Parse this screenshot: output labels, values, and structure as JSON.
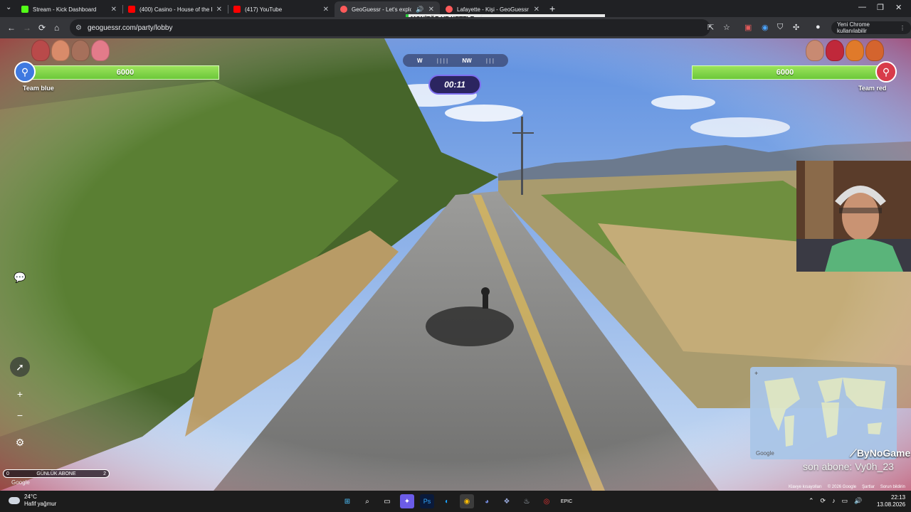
{
  "browser": {
    "tabs": [
      {
        "title": "Stream - Kick Dashboard",
        "favicon_color": "#53fc18",
        "active": false
      },
      {
        "title": "(400) Casino - House of the Ri",
        "favicon_color": "#ff0000",
        "active": false
      },
      {
        "title": "(417) YouTube",
        "favicon_color": "#ff0000",
        "active": false
      },
      {
        "title": "GeoGuessr - Let's explore t",
        "favicon_color": "#ff5a5a",
        "active": true
      },
      {
        "title": "Lafayette - Kişi - GeoGuessr",
        "favicon_color": "#ff5a5a",
        "active": false
      }
    ],
    "url": "geoguessr.com/party/lobby",
    "profile_label": "Yeni Chrome kullanılabilir"
  },
  "stream_banner": {
    "item": "MONİTÖR VE KETTLE 🧉",
    "price_a": "TRY222",
    "price_b": "TRY9999"
  },
  "game": {
    "team_blue": {
      "score": "6000",
      "label": "Team blue",
      "color": "#3f79e0"
    },
    "team_red": {
      "score": "6000",
      "label": "Team red",
      "color": "#d83b4a"
    },
    "compass": {
      "left": "W",
      "right": "NW"
    },
    "timer": "00:11"
  },
  "stream_overlay": {
    "sub_bar_left": "0",
    "sub_bar_label": "GÜNLÜK ABONE",
    "sub_bar_right": "2",
    "brand": "ByNoGame",
    "last_sub": "son abone: Vy0h_23"
  },
  "google": {
    "logo": "Google",
    "footer": [
      "Klavye kısayolları",
      "© 2026 Google",
      "Şartlar",
      "Sorun bildirin"
    ]
  },
  "taskbar": {
    "temp": "24°C",
    "weather": "Hafif yağmur",
    "time": "22:13",
    "date": "13.08.2026"
  }
}
